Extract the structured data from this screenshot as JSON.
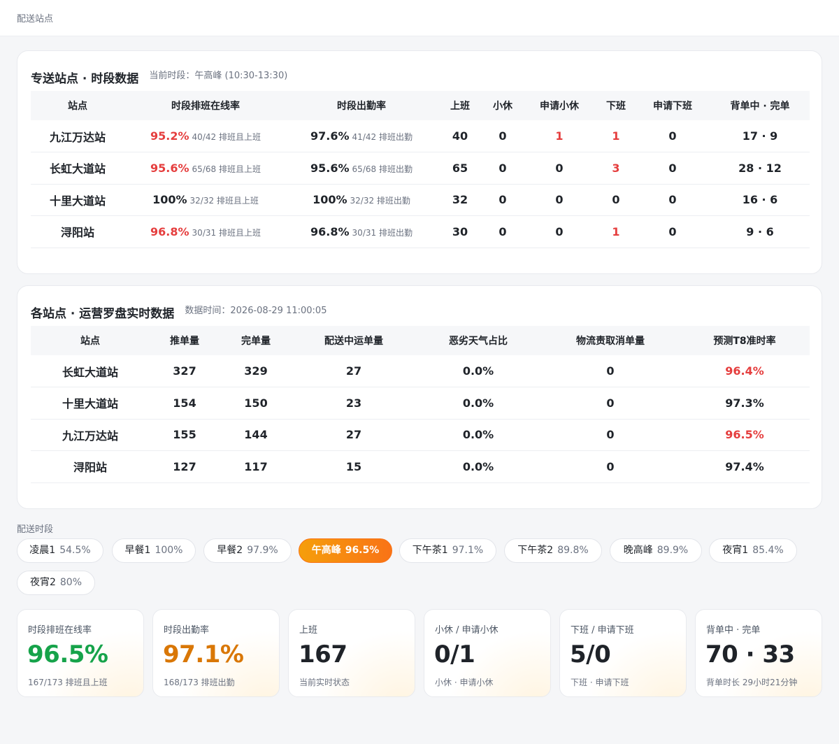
{
  "breadcrumb": "配送站点",
  "card1": {
    "title": "专送站点 · 时段数据",
    "subtitle": "当前时段：午高峰 (10:30-13:30)",
    "headers": [
      "站点",
      "时段排班在线率",
      "时段出勤率",
      "上班",
      "小休",
      "申请小休",
      "下班",
      "申请下班",
      "背单中 · 完单"
    ],
    "rows": [
      {
        "station": "九江万达站",
        "online_pct": "95.2%",
        "online_detail": "40/42 排班且上班",
        "att_pct": "97.6%",
        "att_detail": "41/42 排班出勤",
        "onduty": "40",
        "rest": "0",
        "apply_rest": "1",
        "off": "1",
        "apply_off": "0",
        "carry": "17 · 9"
      },
      {
        "station": "长虹大道站",
        "online_pct": "95.6%",
        "online_detail": "65/68 排班且上班",
        "att_pct": "95.6%",
        "att_detail": "65/68 排班出勤",
        "onduty": "65",
        "rest": "0",
        "apply_rest": "0",
        "off": "3",
        "apply_off": "0",
        "carry": "28 · 12"
      },
      {
        "station": "十里大道站",
        "online_pct": "100%",
        "online_detail": "32/32 排班且上班",
        "att_pct": "100%",
        "att_detail": "32/32 排班出勤",
        "onduty": "32",
        "rest": "0",
        "apply_rest": "0",
        "off": "0",
        "apply_off": "0",
        "carry": "16 · 6"
      },
      {
        "station": "浔阳站",
        "online_pct": "96.8%",
        "online_detail": "30/31 排班且上班",
        "att_pct": "96.8%",
        "att_detail": "30/31 排班出勤",
        "onduty": "30",
        "rest": "0",
        "apply_rest": "0",
        "off": "1",
        "apply_off": "0",
        "carry": "9 · 6"
      }
    ]
  },
  "card2": {
    "title": "各站点 · 运营罗盘实时数据",
    "subtitle": "数据时间：2026-08-29 11:00:05",
    "headers": [
      "站点",
      "推单量",
      "完单量",
      "配送中运单量",
      "恶劣天气占比",
      "物流责取消单量",
      "预测T8准时率"
    ],
    "rows": [
      {
        "station": "长虹大道站",
        "push": "327",
        "done": "329",
        "delivering": "27",
        "weather": "0.0%",
        "cancel": "0",
        "t8": "96.4%"
      },
      {
        "station": "十里大道站",
        "push": "154",
        "done": "150",
        "delivering": "23",
        "weather": "0.0%",
        "cancel": "0",
        "t8": "97.3%"
      },
      {
        "station": "九江万达站",
        "push": "155",
        "done": "144",
        "delivering": "27",
        "weather": "0.0%",
        "cancel": "0",
        "t8": "96.5%"
      },
      {
        "station": "浔阳站",
        "push": "127",
        "done": "117",
        "delivering": "15",
        "weather": "0.0%",
        "cancel": "0",
        "t8": "97.4%"
      }
    ]
  },
  "periods": {
    "label": "配送时段",
    "items": [
      {
        "name": "凌晨1",
        "value": "54.5%"
      },
      {
        "name": "早餐1",
        "value": "100%"
      },
      {
        "name": "早餐2",
        "value": "97.9%"
      },
      {
        "name": "午高峰",
        "value": "96.5%",
        "active": true
      },
      {
        "name": "下午茶1",
        "value": "97.1%"
      },
      {
        "name": "下午茶2",
        "value": "89.8%"
      },
      {
        "name": "晚高峰",
        "value": "89.9%"
      },
      {
        "name": "夜宵1",
        "value": "85.4%"
      },
      {
        "name": "夜宵2",
        "value": "80%"
      }
    ]
  },
  "stats": [
    {
      "label": "时段排班在线率",
      "value": "96.5%",
      "foot": "167/173 排班且上班",
      "color": "#16a34a"
    },
    {
      "label": "时段出勤率",
      "value": "97.1%",
      "foot": "168/173 排班出勤",
      "color": "#d97706"
    },
    {
      "label": "上班",
      "value": "167",
      "foot": "当前实时状态"
    },
    {
      "label": "小休 / 申请小休",
      "value": "0/1",
      "foot": "小休 · 申请小休"
    },
    {
      "label": "下班 / 申请下班",
      "value": "5/0",
      "foot": "下班 · 申请下班"
    },
    {
      "label": "背单中 · 完单",
      "value": "70 · 33",
      "foot": "背单时长 29小时21分钟"
    }
  ],
  "colors": {
    "alert": "#e53e3e",
    "accent": "#f97316",
    "good": "#16a34a",
    "warn": "#d97706"
  }
}
